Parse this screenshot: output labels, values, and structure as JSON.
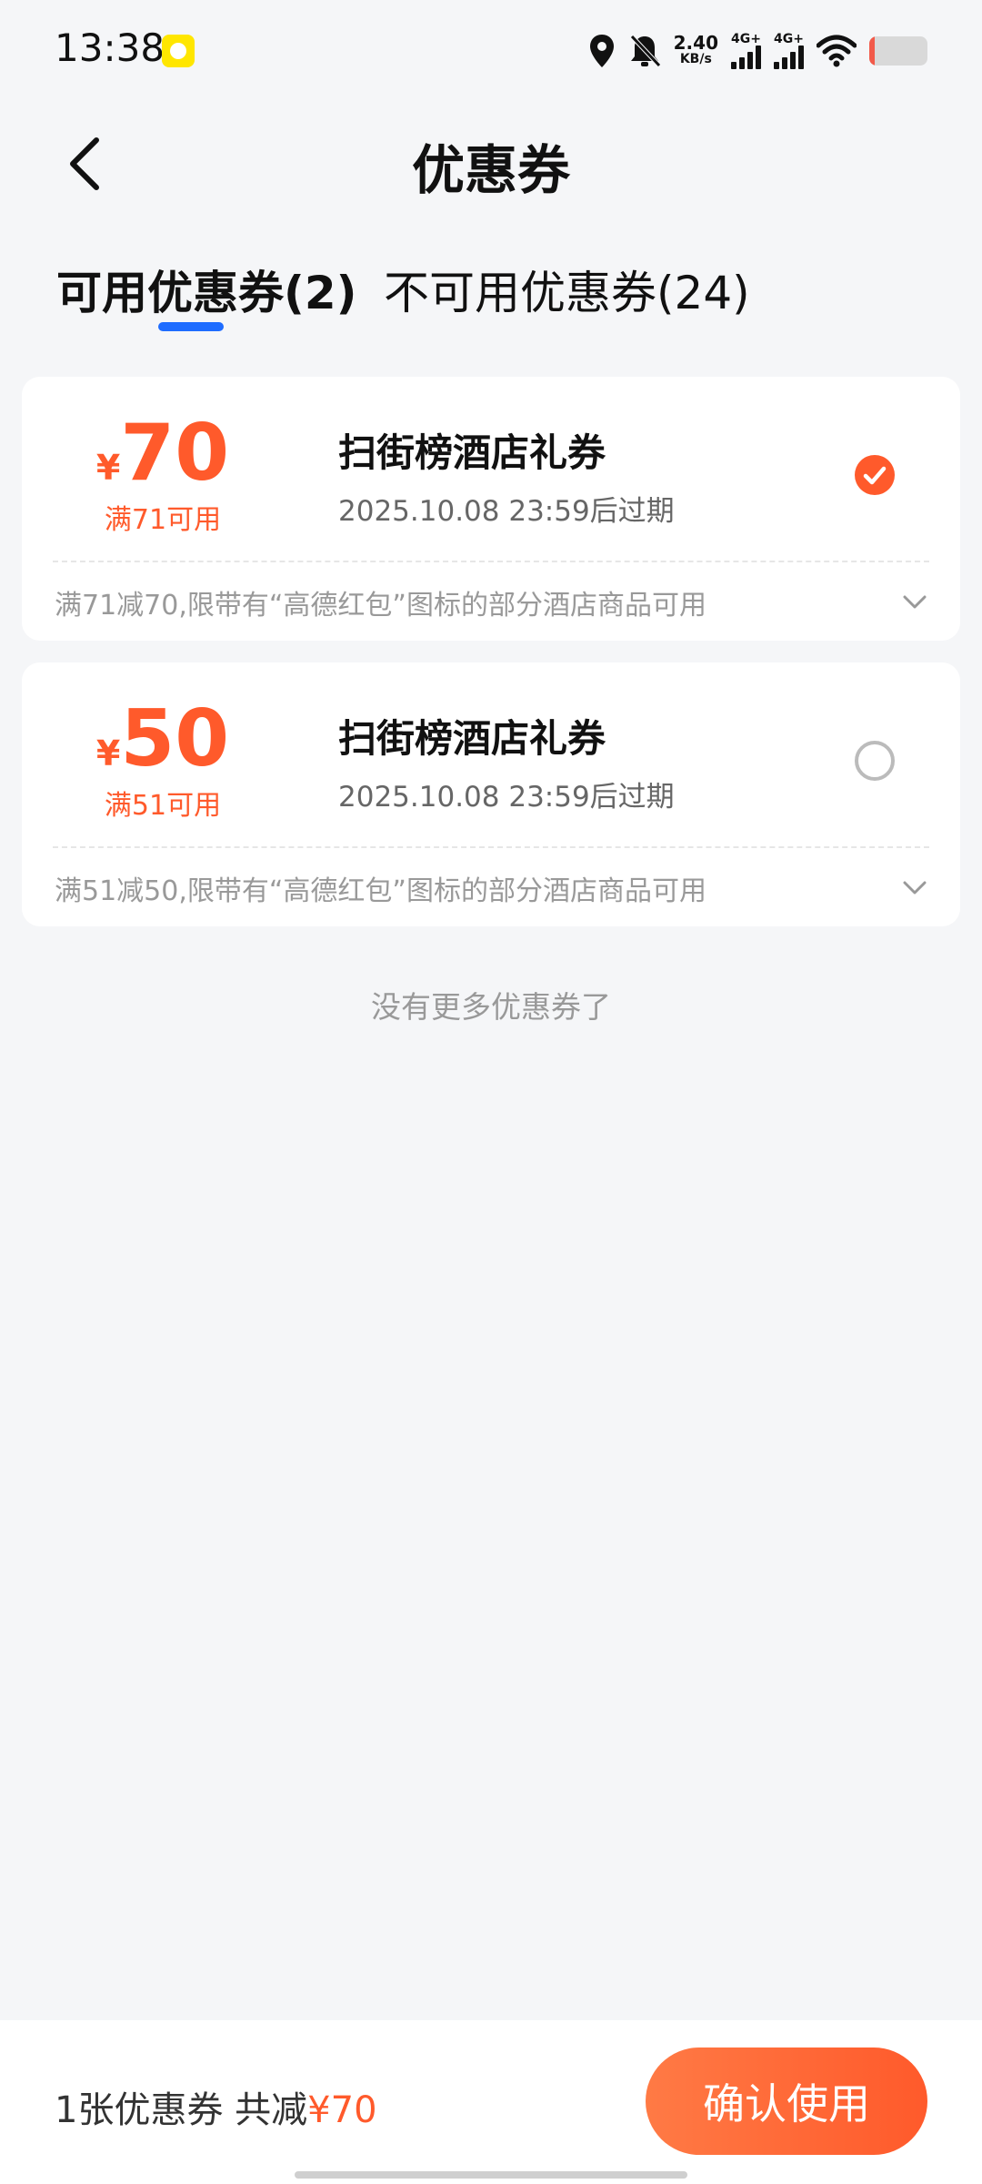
{
  "status_bar": {
    "time": "13:38",
    "network_speed": "2.40",
    "network_speed_unit": "KB/s",
    "signal1_label": "4G+",
    "signal2_label": "4G+",
    "battery_level": 0.1
  },
  "header": {
    "title": "优惠券"
  },
  "tabs": [
    {
      "label": "可用优惠券(2)",
      "active": true
    },
    {
      "label": "不可用优惠券(24)",
      "active": false
    }
  ],
  "coupons": [
    {
      "currency": "¥",
      "amount": "70",
      "condition": "满71可用",
      "title": "扫街榜酒店礼券",
      "expiry": "2025.10.08 23:59后过期",
      "description": "满71减70,限带有“高德红包”图标的部分酒店商品可用",
      "selected": true
    },
    {
      "currency": "¥",
      "amount": "50",
      "condition": "满51可用",
      "title": "扫街榜酒店礼券",
      "expiry": "2025.10.08 23:59后过期",
      "description": "满51减50,限带有“高德红包”图标的部分酒店商品可用",
      "selected": false
    }
  ],
  "no_more_text": "没有更多优惠券了",
  "bottom_bar": {
    "summary_prefix": "1张优惠券 共减",
    "summary_amount": "¥70",
    "confirm_label": "确认使用"
  },
  "colors": {
    "accent": "#FF5A2B",
    "tab_indicator": "#1E6CFF",
    "background": "#F5F6F8"
  }
}
